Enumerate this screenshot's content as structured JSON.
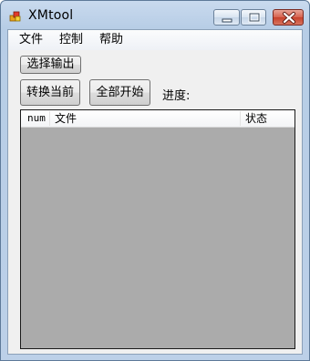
{
  "window": {
    "title": "XMtool"
  },
  "menu": {
    "items": [
      "文件",
      "控制",
      "帮助"
    ]
  },
  "toolbar": {
    "select_output_label": "选择输出",
    "convert_current_label": "转换当前",
    "start_all_label": "全部开始",
    "progress_label": "进度:"
  },
  "list": {
    "columns": [
      "num",
      "文件",
      "状态"
    ],
    "rows": []
  },
  "colors": {
    "list_background": "#ababab",
    "window_frame": "#bcd0e8",
    "close_button": "#c7412b"
  }
}
